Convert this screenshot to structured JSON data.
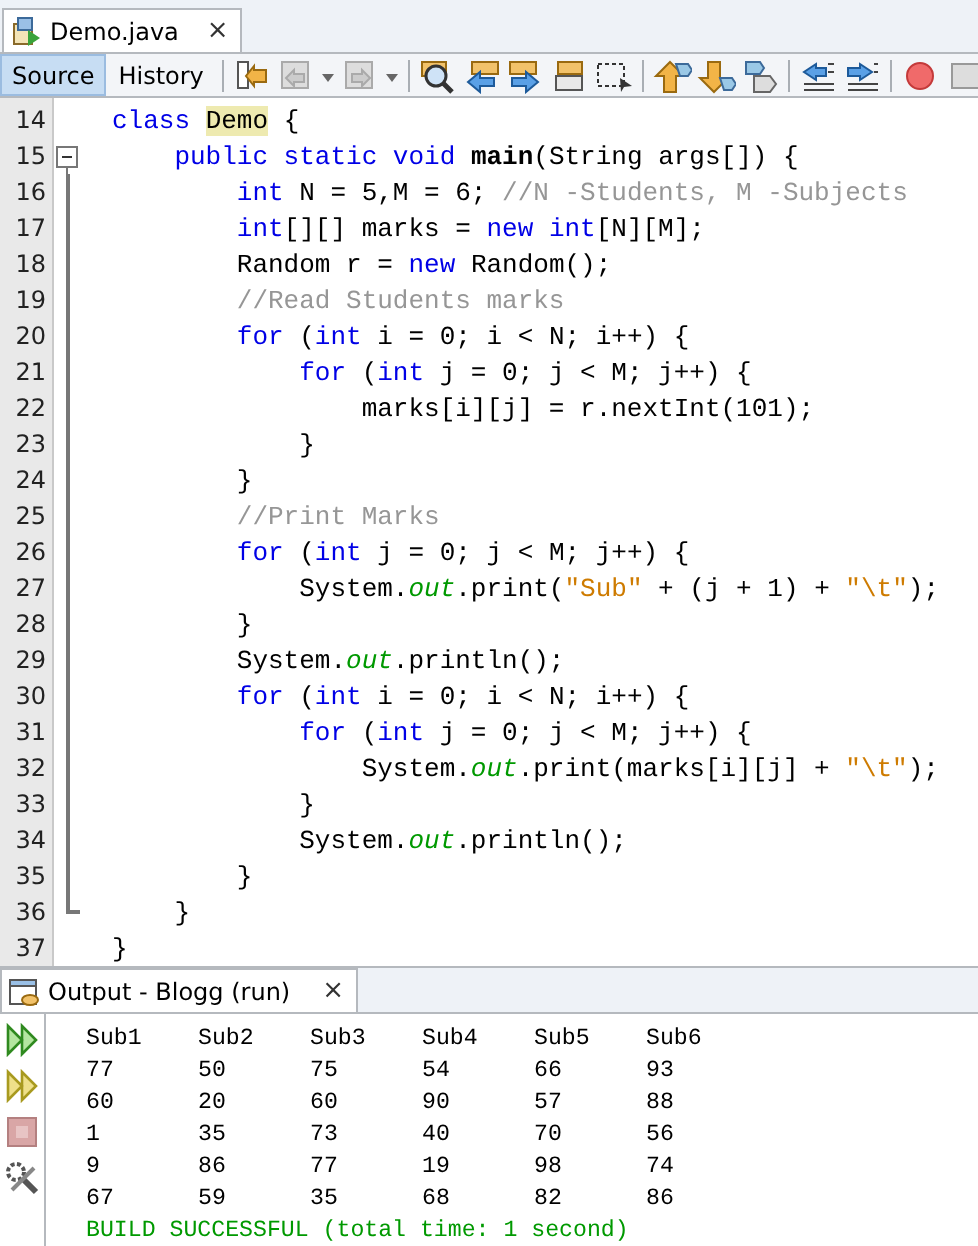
{
  "editor_tab": {
    "title": "Demo.java",
    "close": "×"
  },
  "view_tabs": [
    {
      "label": "Source",
      "selected": true
    },
    {
      "label": "History",
      "selected": false
    }
  ],
  "code": [
    {
      "number": "14",
      "kind": "plain",
      "tokens": [
        {
          "kind": "kw",
          "text": "class "
        },
        {
          "kind": "mark",
          "text": "Demo"
        },
        {
          "kind": "plain",
          "text": " {"
        }
      ]
    },
    {
      "number": "15",
      "kind": "start",
      "tokens": [
        {
          "kind": "kw",
          "text": "    public static void "
        },
        {
          "kind": "bold",
          "text": "main"
        },
        {
          "kind": "plain",
          "text": "(String args[]) {"
        }
      ]
    },
    {
      "number": "16",
      "kind": "guide",
      "tokens": [
        {
          "kind": "kw",
          "text": "        int"
        },
        {
          "kind": "plain",
          "text": " N = 5,M = 6; "
        },
        {
          "kind": "comment",
          "text": "//N -Students, M -Subjects"
        }
      ]
    },
    {
      "number": "17",
      "kind": "guide",
      "tokens": [
        {
          "kind": "kw",
          "text": "        int"
        },
        {
          "kind": "plain",
          "text": "[][] marks = "
        },
        {
          "kind": "kw",
          "text": "new int"
        },
        {
          "kind": "plain",
          "text": "[N][M];"
        }
      ]
    },
    {
      "number": "18",
      "kind": "guide",
      "tokens": [
        {
          "kind": "plain",
          "text": "        Random r = "
        },
        {
          "kind": "kw",
          "text": "new"
        },
        {
          "kind": "plain",
          "text": " Random();"
        }
      ]
    },
    {
      "number": "19",
      "kind": "guide",
      "tokens": [
        {
          "kind": "comment",
          "text": "        //Read Students marks"
        }
      ]
    },
    {
      "number": "20",
      "kind": "guide",
      "tokens": [
        {
          "kind": "kw",
          "text": "        for"
        },
        {
          "kind": "plain",
          "text": " ("
        },
        {
          "kind": "kw",
          "text": "int"
        },
        {
          "kind": "plain",
          "text": " i = 0; i < N; i++) {"
        }
      ]
    },
    {
      "number": "21",
      "kind": "guide",
      "tokens": [
        {
          "kind": "kw",
          "text": "            for"
        },
        {
          "kind": "plain",
          "text": " ("
        },
        {
          "kind": "kw",
          "text": "int"
        },
        {
          "kind": "plain",
          "text": " j = 0; j < M; j++) {"
        }
      ]
    },
    {
      "number": "22",
      "kind": "guide",
      "tokens": [
        {
          "kind": "plain",
          "text": "                marks[i][j] = r.nextInt(101);"
        }
      ]
    },
    {
      "number": "23",
      "kind": "guide",
      "tokens": [
        {
          "kind": "plain",
          "text": "            }"
        }
      ]
    },
    {
      "number": "24",
      "kind": "guide",
      "tokens": [
        {
          "kind": "plain",
          "text": "        }"
        }
      ]
    },
    {
      "number": "25",
      "kind": "guide",
      "tokens": [
        {
          "kind": "comment",
          "text": "        //Print Marks"
        }
      ]
    },
    {
      "number": "26",
      "kind": "guide",
      "tokens": [
        {
          "kind": "kw",
          "text": "        for"
        },
        {
          "kind": "plain",
          "text": " ("
        },
        {
          "kind": "kw",
          "text": "int"
        },
        {
          "kind": "plain",
          "text": " j = 0; j < M; j++) {"
        }
      ]
    },
    {
      "number": "27",
      "kind": "guide",
      "tokens": [
        {
          "kind": "plain",
          "text": "            System."
        },
        {
          "kind": "field",
          "text": "out"
        },
        {
          "kind": "plain",
          "text": ".print("
        },
        {
          "kind": "string",
          "text": "\"Sub\""
        },
        {
          "kind": "plain",
          "text": " + (j + 1) + "
        },
        {
          "kind": "string",
          "text": "\"\\t\""
        },
        {
          "kind": "plain",
          "text": ");"
        }
      ]
    },
    {
      "number": "28",
      "kind": "guide",
      "tokens": [
        {
          "kind": "plain",
          "text": "        }"
        }
      ]
    },
    {
      "number": "29",
      "kind": "guide",
      "tokens": [
        {
          "kind": "plain",
          "text": "        System."
        },
        {
          "kind": "field",
          "text": "out"
        },
        {
          "kind": "plain",
          "text": ".println();"
        }
      ]
    },
    {
      "number": "30",
      "kind": "guide",
      "tokens": [
        {
          "kind": "kw",
          "text": "        for"
        },
        {
          "kind": "plain",
          "text": " ("
        },
        {
          "kind": "kw",
          "text": "int"
        },
        {
          "kind": "plain",
          "text": " i = 0; i < N; i++) {"
        }
      ]
    },
    {
      "number": "31",
      "kind": "guide",
      "tokens": [
        {
          "kind": "kw",
          "text": "            for"
        },
        {
          "kind": "plain",
          "text": " ("
        },
        {
          "kind": "kw",
          "text": "int"
        },
        {
          "kind": "plain",
          "text": " j = 0; j < M; j++) {"
        }
      ]
    },
    {
      "number": "32",
      "kind": "guide",
      "tokens": [
        {
          "kind": "plain",
          "text": "                System."
        },
        {
          "kind": "field",
          "text": "out"
        },
        {
          "kind": "plain",
          "text": ".print(marks[i][j] + "
        },
        {
          "kind": "string",
          "text": "\"\\t\""
        },
        {
          "kind": "plain",
          "text": ");"
        }
      ]
    },
    {
      "number": "33",
      "kind": "guide",
      "tokens": [
        {
          "kind": "plain",
          "text": "            }"
        }
      ]
    },
    {
      "number": "34",
      "kind": "guide",
      "tokens": [
        {
          "kind": "plain",
          "text": "            System."
        },
        {
          "kind": "field",
          "text": "out"
        },
        {
          "kind": "plain",
          "text": ".println();"
        }
      ]
    },
    {
      "number": "35",
      "kind": "guide",
      "tokens": [
        {
          "kind": "plain",
          "text": "        }"
        }
      ]
    },
    {
      "number": "36",
      "kind": "end",
      "tokens": [
        {
          "kind": "plain",
          "text": "    }"
        }
      ]
    },
    {
      "number": "37",
      "kind": "plain",
      "tokens": [
        {
          "kind": "plain",
          "text": "}"
        }
      ]
    }
  ],
  "output": {
    "title": "Output - Blogg (run)",
    "close": "×",
    "header": [
      "Sub1",
      "Sub2",
      "Sub3",
      "Sub4",
      "Sub5",
      "Sub6"
    ],
    "rows": [
      [
        "77",
        "50",
        "75",
        "54",
        "66",
        "93"
      ],
      [
        "60",
        "20",
        "60",
        "90",
        "57",
        "88"
      ],
      [
        "1",
        "35",
        "73",
        "40",
        "70",
        "56"
      ],
      [
        "9",
        "86",
        "77",
        "19",
        "98",
        "74"
      ],
      [
        "67",
        "59",
        "35",
        "68",
        "82",
        "86"
      ]
    ],
    "status": "BUILD SUCCESSFUL (total time: 1 second)"
  }
}
